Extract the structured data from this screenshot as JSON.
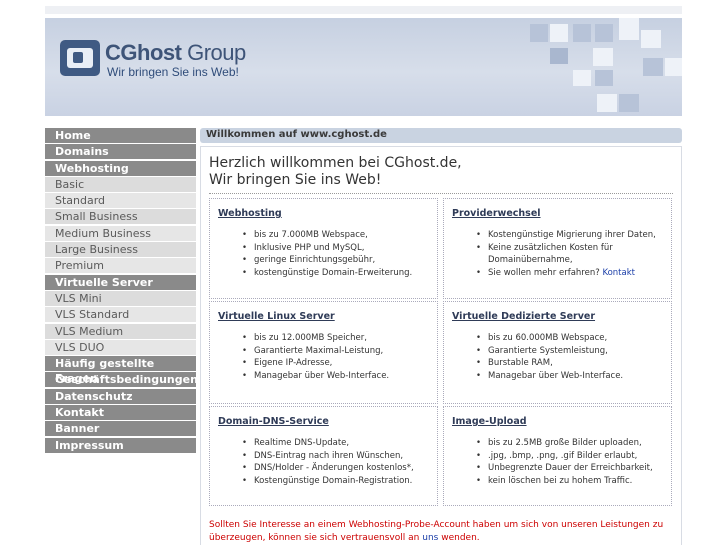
{
  "header": {
    "brand_main": "CGhost",
    "brand_group": "Group",
    "tagline": "Wir bringen Sie ins Web!"
  },
  "nav": [
    {
      "label": "Home",
      "type": "main"
    },
    {
      "label": "Domains",
      "type": "main"
    },
    {
      "label": "Webhosting",
      "type": "main"
    },
    {
      "label": "Basic",
      "type": "sub"
    },
    {
      "label": "Standard",
      "type": "sub"
    },
    {
      "label": "Small Business",
      "type": "sub"
    },
    {
      "label": "Medium Business",
      "type": "sub"
    },
    {
      "label": "Large Business",
      "type": "sub"
    },
    {
      "label": "Premium",
      "type": "sub"
    },
    {
      "label": "Virtuelle Server",
      "type": "main"
    },
    {
      "label": "VLS Mini",
      "type": "sub"
    },
    {
      "label": "VLS Standard",
      "type": "sub"
    },
    {
      "label": "VLS Medium",
      "type": "sub"
    },
    {
      "label": "VLS DUO",
      "type": "sub"
    },
    {
      "label": "Häufig gestellte Fragen",
      "type": "main"
    },
    {
      "label": "Geschäftsbedingungen",
      "type": "main"
    },
    {
      "label": "Datenschutz",
      "type": "main"
    },
    {
      "label": "Kontakt",
      "type": "main"
    },
    {
      "label": "Banner",
      "type": "main"
    },
    {
      "label": "Impressum",
      "type": "main"
    }
  ],
  "bar": {
    "title": "Willkommen auf www.cghost.de"
  },
  "welcome": {
    "line1": "Herzlich willkommen bei CGhost.de,",
    "line2": "Wir bringen Sie ins Web!"
  },
  "boxes": [
    {
      "title": "Webhosting",
      "items": [
        "bis zu 7.000MB Webspace,",
        "Inklusive PHP und MySQL,",
        "geringe Einrichtungsgebühr,",
        "kostengünstige Domain-Erweiterung."
      ]
    },
    {
      "title": "Providerwechsel",
      "items": [
        "Kostengünstige Migrierung ihrer Daten,",
        "Keine zusätzlichen Kosten für Domainübernahme,",
        "Sie wollen mehr erfahren?"
      ],
      "link": "Kontakt"
    },
    {
      "title": "Virtuelle Linux Server",
      "items": [
        "bis zu 12.000MB Speicher,",
        "Garantierte Maximal-Leistung,",
        "Eigene IP-Adresse,",
        "Managebar über Web-Interface."
      ]
    },
    {
      "title": "Virtuelle Dedizierte Server",
      "items": [
        "bis zu 60.000MB Webspace,",
        "Garantierte Systemleistung,",
        "Burstable RAM,",
        "Managebar über Web-Interface."
      ]
    },
    {
      "title": "Domain-DNS-Service",
      "items": [
        "Realtime DNS-Update,",
        "DNS-Eintrag nach ihren Wünschen,",
        "DNS/Holder - Änderungen kostenlos*,",
        "Kostengünstige Domain-Registration."
      ]
    },
    {
      "title": "Image-Upload",
      "items": [
        "bis zu 2.5MB große Bilder uploaden,",
        ".jpg, .bmp, .png, .gif Bilder erlaubt,",
        "Unbegrenzte Dauer der Erreichbarkeit,",
        "kein löschen bei zu hohem Traffic."
      ]
    }
  ],
  "footer": {
    "text_before": "Sollten Sie Interesse an einem Webhosting-Probe-Account haben um sich von unseren Leistungen zu überzeugen, können sie sich vertrauensvoll an",
    "link": "uns",
    "text_after": "wenden."
  }
}
